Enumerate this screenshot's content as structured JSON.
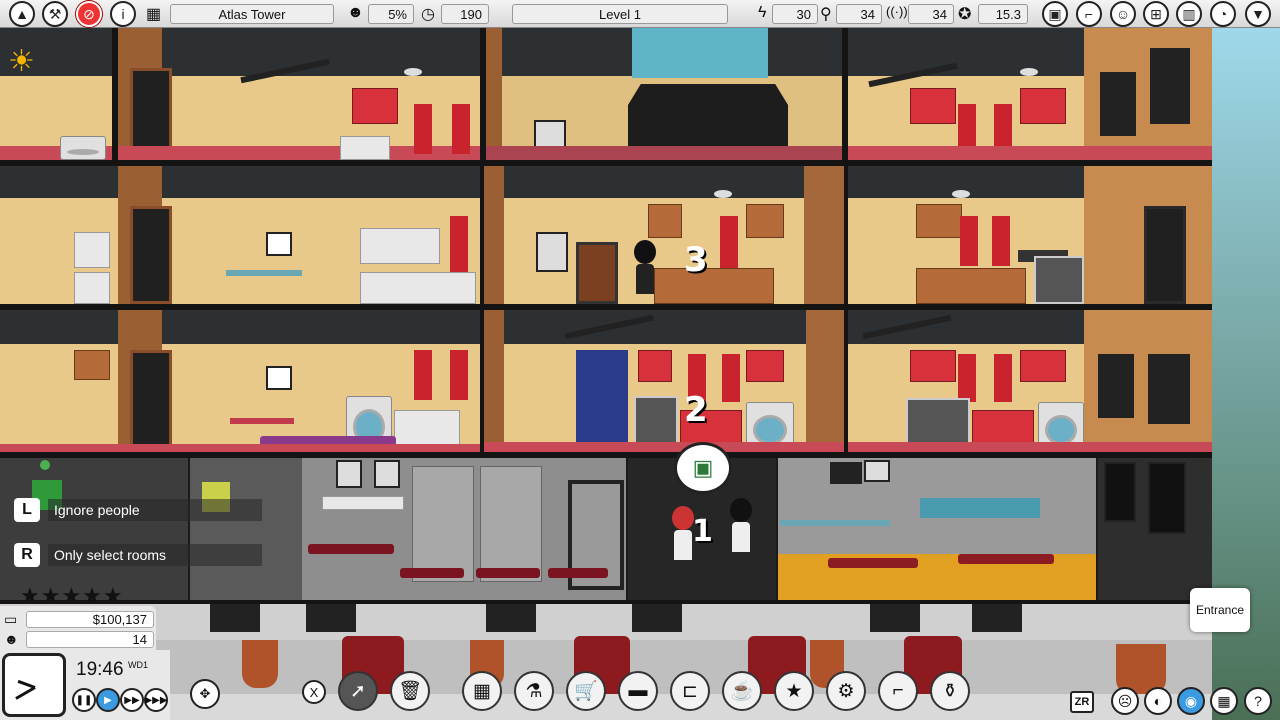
{
  "topbar": {
    "tower_name": "Atlas Tower",
    "satisfaction": "5%",
    "time_value": "190",
    "level": "Level 1",
    "power": "30",
    "water": "34",
    "signal": "34",
    "rating_value": "15.3"
  },
  "floor_numbers": [
    "3",
    "2",
    "1"
  ],
  "hints": [
    {
      "key": "L",
      "text": "Ignore people"
    },
    {
      "key": "R",
      "text": "Only select rooms"
    }
  ],
  "stars": "★★★★★",
  "stats": {
    "money": "$100,137",
    "population": "14"
  },
  "clock": {
    "time": "19:46",
    "day": "WD1"
  },
  "speed_controls": [
    "❚❚",
    "▶",
    "▶▶",
    "▶▶▶"
  ],
  "entrance_label": "Entrance",
  "zr_key": "ZR",
  "x_key": "X",
  "colors": {
    "wall": "#e9c98a",
    "floor_red": "#c84a57",
    "cabinet_red": "#d7323b",
    "accent_blue": "#3a9be0"
  },
  "icons": {
    "top_left": [
      "up-arrow-icon",
      "hammer-icon",
      "no-entry-icon",
      "info-icon",
      "building-icon"
    ],
    "top_right": [
      "cube-icon",
      "stairs-icon",
      "people-icon",
      "network-icon",
      "bar-chart-icon",
      "pie-chart-icon",
      "dropdown-icon"
    ],
    "bottom_tools": [
      "cursor-icon",
      "trash-icon",
      "add-room-icon",
      "plumbing-icon",
      "cart-icon",
      "sofa-icon",
      "bed-icon",
      "coffee-icon",
      "stars-icon",
      "gear-icon",
      "stairs-icon",
      "vase-icon"
    ],
    "bottom_right": [
      "sad-face-icon",
      "contrast-icon",
      "eye-icon",
      "grid-icon",
      "help-icon"
    ]
  }
}
